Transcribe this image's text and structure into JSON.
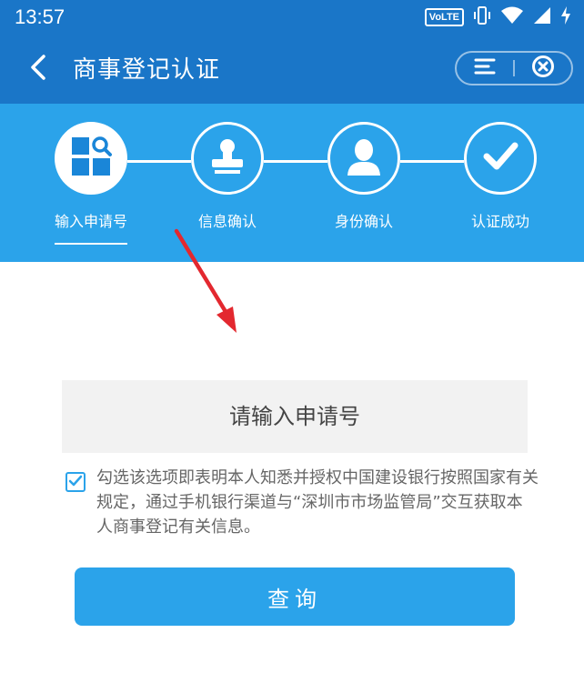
{
  "status_bar": {
    "time": "13:57",
    "network_badge": "VoLTE",
    "icons": [
      "vibrate-icon",
      "wifi-icon",
      "cellular-signal-icon",
      "battery-charging-icon"
    ]
  },
  "header": {
    "title": "商事登记认证",
    "back_icon": "back-chevron-icon",
    "menu_icon": "menu-icon",
    "close_icon": "close-circle-icon"
  },
  "steps": {
    "active_index": 0,
    "items": [
      {
        "label": "输入申请号",
        "icon": "grid-search-icon"
      },
      {
        "label": "信息确认",
        "icon": "stamp-icon"
      },
      {
        "label": "身份确认",
        "icon": "person-icon"
      },
      {
        "label": "认证成功",
        "icon": "checkmark-icon"
      }
    ]
  },
  "form": {
    "application_number_placeholder": "请输入申请号",
    "application_number_value": "",
    "agreement_checked": true,
    "agreement_text": "勾选该选项即表明本人知悉并授权中国建设银行按照国家有关规定，通过手机银行渠道与“深圳市市场监管局”交互获取本人商事登记有关信息。",
    "query_button_label": "查询"
  },
  "colors": {
    "header_blue": "#1a76c8",
    "steps_blue": "#2ba3ea",
    "button_blue": "#2ba3ea",
    "annotation_arrow_red": "#e3282f"
  }
}
